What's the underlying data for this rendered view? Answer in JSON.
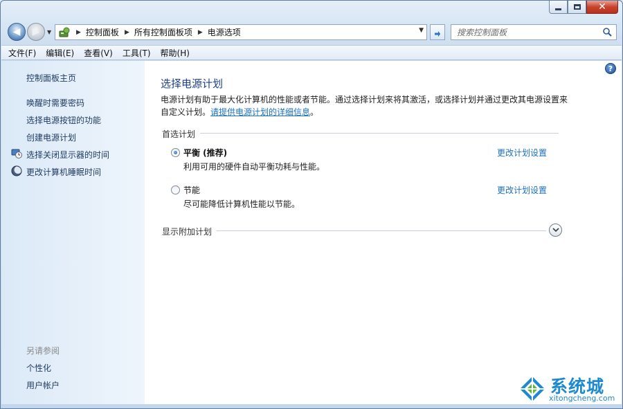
{
  "address_bar": {
    "breadcrumbs": [
      "控制面板",
      "所有控制面板项",
      "电源选项"
    ]
  },
  "search": {
    "placeholder": "搜索控制面板"
  },
  "menu": [
    "文件(F)",
    "编辑(E)",
    "查看(V)",
    "工具(T)",
    "帮助(H)"
  ],
  "sidebar": {
    "home": "控制面板主页",
    "links": [
      {
        "label": "唤醒时需要密码"
      },
      {
        "label": "选择电源按钮的功能"
      },
      {
        "label": "创建电源计划"
      },
      {
        "label": "选择关闭显示器的时间",
        "icon": "monitor-clock-icon"
      },
      {
        "label": "更改计算机睡眠时间",
        "icon": "moon-icon"
      }
    ],
    "see_also_heading": "另请参阅",
    "see_also": [
      "个性化",
      "用户帐户"
    ]
  },
  "main": {
    "title": "选择电源计划",
    "intro_text": "电源计划有助于最大化计算机的性能或者节能。通过选择计划来将其激活，或选择计划并通过更改其电源设置来自定义计划。",
    "intro_link": "请提供电源计划的详细信息",
    "intro_end": "。",
    "preferred_heading": "首选计划",
    "plans": [
      {
        "name": "平衡 (推荐)",
        "description": "利用可用的硬件自动平衡功耗与性能。",
        "selected": true,
        "change_link": "更改计划设置"
      },
      {
        "name": "节能",
        "description": "尽可能降低计算机性能以节能。",
        "selected": false,
        "change_link": "更改计划设置"
      }
    ],
    "additional_heading": "显示附加计划"
  },
  "watermark": {
    "name": "系统城",
    "url": "xitongcheng.com"
  },
  "colors": {
    "title_blue": "#1b3f8b",
    "link_blue": "#1a6fc0",
    "sidebar_bg": "#dbe9f7"
  }
}
